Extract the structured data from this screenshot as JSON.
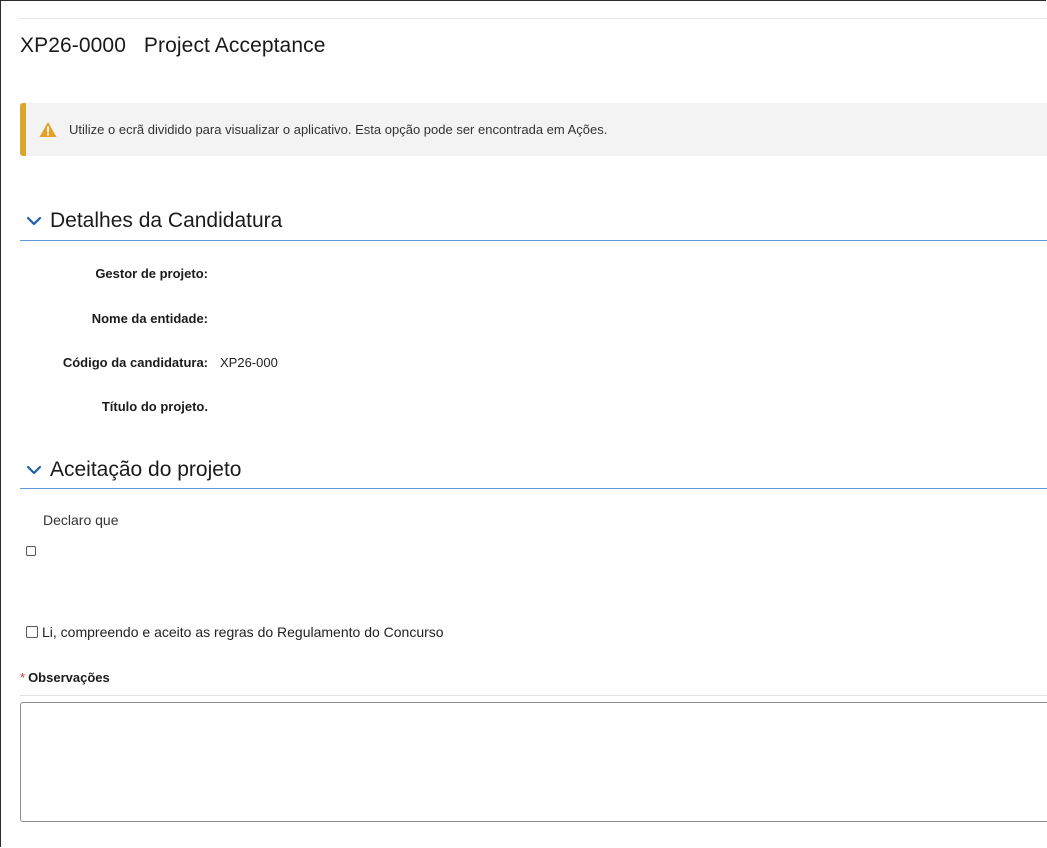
{
  "header": {
    "code": "XP26-0000",
    "title": "Project Acceptance"
  },
  "warning": {
    "icon": "warning-triangle-icon",
    "text": "Utilize o ecrã dividido para visualizar o aplicativo. Esta opção pode ser encontrada em Ações.",
    "accent_color": "#d9a62b"
  },
  "sections": {
    "details": {
      "label": "Detalhes da Candidatura",
      "fields": [
        {
          "label": "Gestor de projeto:",
          "value": ""
        },
        {
          "label": "Nome da entidade:",
          "value": ""
        },
        {
          "label": "Código da candidatura:",
          "value": "XP26-000"
        },
        {
          "label": "Título do projeto.",
          "value": ""
        }
      ]
    },
    "acceptance": {
      "label": "Aceitação do projeto",
      "declaro_text": "Declaro que",
      "declaro_checked": false,
      "rules_text": "Li, compreendo e aceito as regras do Regulamento do Concurso",
      "rules_checked": false
    }
  },
  "observacoes": {
    "required_mark": "*",
    "label": "Observações",
    "value": ""
  },
  "colors": {
    "section_rule": "#5e9ed6",
    "required": "#c23934"
  }
}
